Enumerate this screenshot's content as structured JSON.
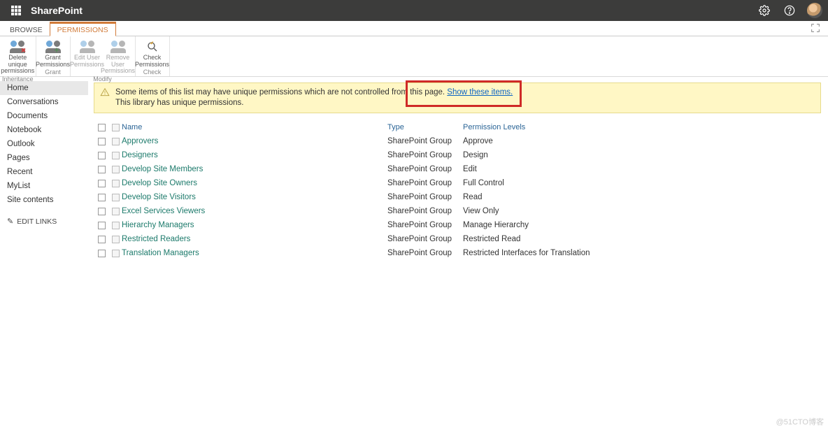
{
  "suite": {
    "title": "SharePoint"
  },
  "tabs": {
    "browse": "BROWSE",
    "permissions": "PERMISSIONS"
  },
  "ribbon": {
    "delete_unique": "Delete unique\npermissions",
    "grant": "Grant\nPermissions",
    "edit_user": "Edit User\nPermissions",
    "remove_user": "Remove User\nPermissions",
    "check": "Check\nPermissions",
    "group_inheritance": "Inheritance",
    "group_grant": "Grant",
    "group_modify": "Modify",
    "group_check": "Check"
  },
  "sidebar": {
    "items": [
      "Home",
      "Conversations",
      "Documents",
      "Notebook",
      "Outlook",
      "Pages",
      "Recent",
      "MyList",
      "Site contents"
    ],
    "edit_links": "EDIT LINKS"
  },
  "notif": {
    "line1a": "Some items of this list may have unique permissions which are not controlled from this page.  ",
    "link": "Show these items.",
    "line2": "This library has unique permissions."
  },
  "table": {
    "head_name": "Name",
    "head_type": "Type",
    "head_perm": "Permission Levels",
    "rows": [
      {
        "name": "Approvers",
        "type": "SharePoint Group",
        "perm": "Approve"
      },
      {
        "name": "Designers",
        "type": "SharePoint Group",
        "perm": "Design"
      },
      {
        "name": "Develop Site Members",
        "type": "SharePoint Group",
        "perm": "Edit"
      },
      {
        "name": "Develop Site Owners",
        "type": "SharePoint Group",
        "perm": "Full Control"
      },
      {
        "name": "Develop Site Visitors",
        "type": "SharePoint Group",
        "perm": "Read"
      },
      {
        "name": "Excel Services Viewers",
        "type": "SharePoint Group",
        "perm": "View Only"
      },
      {
        "name": "Hierarchy Managers",
        "type": "SharePoint Group",
        "perm": "Manage Hierarchy"
      },
      {
        "name": "Restricted Readers",
        "type": "SharePoint Group",
        "perm": "Restricted Read"
      },
      {
        "name": "Translation Managers",
        "type": "SharePoint Group",
        "perm": "Restricted Interfaces for Translation"
      }
    ]
  },
  "watermark": "@51CTO博客"
}
